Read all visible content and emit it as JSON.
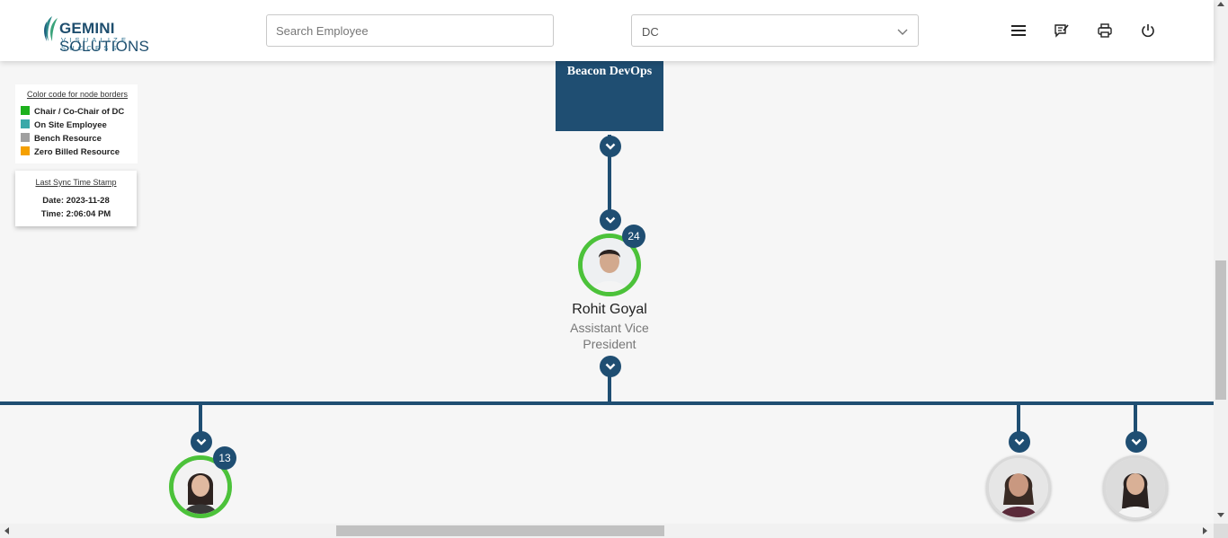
{
  "header": {
    "logo_name_bold": "GEMINI",
    "logo_name_rest": " SOLUTIONS",
    "logo_tagline": "VISUALIZE SUCCESS",
    "search_placeholder": "Search Employee",
    "dept_select_value": "DC",
    "icons": [
      "menu-icon",
      "feedback-icon",
      "print-icon",
      "power-icon"
    ]
  },
  "legend": {
    "title": "Color code for node borders",
    "items": [
      {
        "label": "Chair / Co-Chair of DC",
        "color": "#1db11d"
      },
      {
        "label": "On Site Employee",
        "color": "#3aa9a9"
      },
      {
        "label": "Bench Resource",
        "color": "#a0a0a0"
      },
      {
        "label": "Zero Billed Resource",
        "color": "#f5a000"
      }
    ]
  },
  "sync": {
    "title": "Last Sync Time Stamp",
    "date": "Date: 2023-11-28",
    "time": "Time: 2:06:04 PM"
  },
  "org": {
    "department": "Beacon DevOps",
    "root": {
      "name": "Rohit Goyal",
      "title_line1": "Assistant Vice",
      "title_line2": "President",
      "reports_count": "24",
      "border_color": "#4cc23a"
    },
    "children": [
      {
        "reports_count": "13",
        "border": "green"
      },
      {
        "border": "plain"
      },
      {
        "border": "plain"
      }
    ]
  },
  "colors": {
    "primary": "#1f4e72",
    "chair_border": "#4cc23a"
  }
}
